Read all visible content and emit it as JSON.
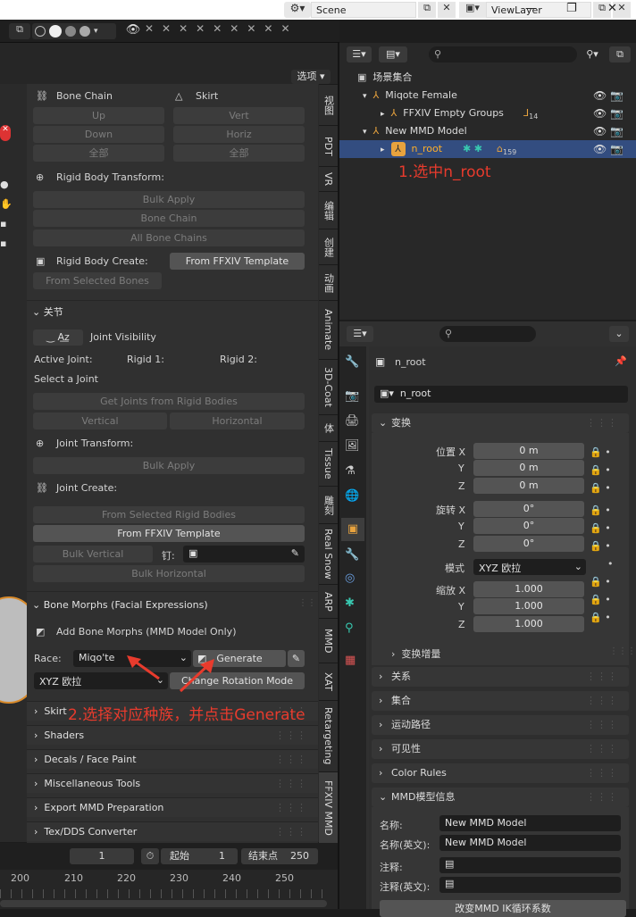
{
  "window": {
    "scene_label": "Scene",
    "viewlayer_label": "ViewLayer",
    "minimize": "—",
    "maximize": "❐",
    "close": "✕"
  },
  "viewport": {
    "options_label": "选项"
  },
  "bone_chain": {
    "title": "Bone Chain",
    "up": "Up",
    "down": "Down",
    "all": "全部"
  },
  "skirt_group": {
    "title": "Skirt",
    "vert": "Vert",
    "horiz": "Horiz",
    "all": "全部"
  },
  "rigid_body_transform": {
    "title": "Rigid Body Transform:",
    "bulk_apply": "Bulk Apply",
    "bone_chain": "Bone Chain",
    "all_bone_chains": "All Bone Chains"
  },
  "rigid_body_create": {
    "title": "Rigid Body Create:",
    "from_template": "From FFXIV Template",
    "from_selected_bones": "From Selected Bones"
  },
  "joints": {
    "section": "关节",
    "visibility": "Joint Visibility",
    "active_joint": "Active Joint:",
    "rigid1": "Rigid 1:",
    "rigid2": "Rigid 2:",
    "select": "Select a Joint",
    "get_joints": "Get Joints from Rigid Bodies",
    "vertical": "Vertical",
    "horizontal": "Horizontal",
    "transform_title": "Joint Transform:",
    "bulk_apply": "Bulk Apply",
    "create_title": "Joint Create:",
    "from_selected_rigid": "From Selected Rigid Bodies",
    "from_template": "From FFXIV Template",
    "bulk_vertical": "Bulk Vertical",
    "pin_label": "钉:",
    "bulk_horizontal": "Bulk Horizontal"
  },
  "bone_morphs": {
    "section": "Bone Morphs (Facial Expressions)",
    "add": "Add Bone Morphs (MMD Model Only)",
    "race_label": "Race:",
    "race_value": "Miqo'te",
    "generate": "Generate",
    "rotation_mode": "XYZ 欧拉",
    "change_rotation": "Change Rotation Mode"
  },
  "collapsed_sections": [
    "Skirt",
    "Shaders",
    "Decals / Face Paint",
    "Miscellaneous Tools",
    "Export MMD Preparation",
    "Tex/DDS Converter"
  ],
  "sidebar_tabs": [
    "视图",
    "PDT",
    "VR",
    "编辑",
    "创建",
    "动画",
    "Animate",
    "3D-Coat",
    "体",
    "Tissue",
    "雕刻",
    "Real Snow",
    "ARP",
    "MMD",
    "XAT",
    "Retargeting",
    "FFXIV MMD"
  ],
  "timeline": {
    "current_frame": "1",
    "start_label": "起始",
    "start_value": "1",
    "end_label": "结束点",
    "end_value": "250",
    "ticks": [
      "200",
      "210",
      "220",
      "230",
      "240",
      "250"
    ]
  },
  "annotations": {
    "step1": "1.选中n_root",
    "step2": "2.选择对应种族，并点击Generate"
  },
  "outliner": {
    "root": "场景集合",
    "items": [
      {
        "name": "Miqote Female",
        "depth": 1
      },
      {
        "name": "FFXIV Empty Groups",
        "depth": 2,
        "badge": "14"
      },
      {
        "name": "New MMD Model",
        "depth": 1
      },
      {
        "name": "n_root",
        "depth": 2,
        "badge": "159",
        "selected": true
      }
    ]
  },
  "properties": {
    "object_name": "n_root",
    "data_name": "n_root",
    "transform_section": "变换",
    "loc_label": "位置 X",
    "loc": [
      "0 m",
      "0 m",
      "0 m"
    ],
    "rot_label": "旋转 X",
    "rot": [
      "0°",
      "0°",
      "0°"
    ],
    "mode_label": "模式",
    "mode_value": "XYZ 欧拉",
    "scale_label": "缩放 X",
    "scale": [
      "1.000",
      "1.000",
      "1.000"
    ],
    "y": "Y",
    "z": "Z",
    "delta": "变换增量",
    "sections": [
      "关系",
      "集合",
      "运动路径",
      "可见性",
      "Color Rules"
    ],
    "mmd_section": "MMD模型信息",
    "name_label": "名称:",
    "name_value": "New MMD Model",
    "name_en_label": "名称(英文):",
    "name_en_value": "New MMD Model",
    "comment_label": "注释:",
    "comment_en_label": "注释(英文):",
    "ik_button": "改变MMD IK循环系数"
  }
}
